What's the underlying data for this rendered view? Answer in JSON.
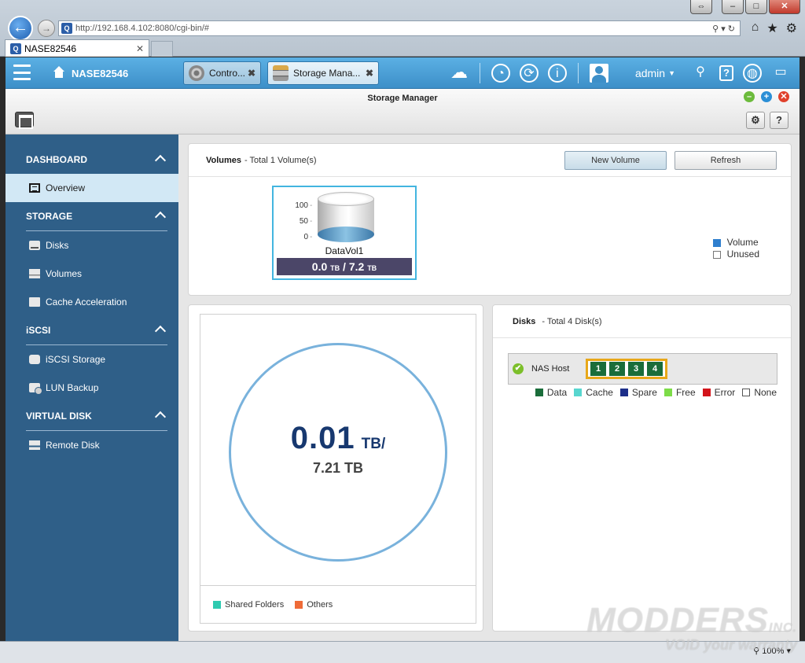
{
  "browser": {
    "url_host": "http://192.168.4.102",
    "url_rest": ":8080/cgi-bin/#",
    "tab_title": "NASE82546",
    "zoom": "100%"
  },
  "header": {
    "host_name": "NASE82546",
    "tabs": [
      {
        "label": "Contro..."
      },
      {
        "label": "Storage Mana..."
      }
    ],
    "user": "admin"
  },
  "window": {
    "title": "Storage Manager"
  },
  "sidebar": {
    "sections": [
      {
        "label": "DASHBOARD",
        "items": [
          {
            "label": "Overview"
          }
        ]
      },
      {
        "label": "STORAGE",
        "items": [
          {
            "label": "Disks"
          },
          {
            "label": "Volumes"
          },
          {
            "label": "Cache Acceleration"
          }
        ]
      },
      {
        "label": "iSCSI",
        "items": [
          {
            "label": "iSCSI Storage"
          },
          {
            "label": "LUN Backup"
          }
        ]
      },
      {
        "label": "VIRTUAL DISK",
        "items": [
          {
            "label": "Remote Disk"
          }
        ]
      }
    ]
  },
  "volumes": {
    "title": "Volumes",
    "subtitle": "- Total 1 Volume(s)",
    "new_label": "New Volume",
    "refresh_label": "Refresh",
    "scale": [
      "100",
      "50",
      "0"
    ],
    "volume_name": "DataVol1",
    "used": "0.0",
    "used_unit": "TB",
    "separator": "/",
    "total": "7.2",
    "total_unit": "TB",
    "legend_volume": "Volume",
    "legend_unused": "Unused"
  },
  "capacity": {
    "used": "0.01",
    "used_unit": "TB/",
    "total": "7.21 TB",
    "legend_shared": "Shared Folders",
    "legend_others": "Others"
  },
  "disks": {
    "title": "Disks",
    "subtitle": "- Total 4 Disk(s)",
    "host_label": "NAS Host",
    "bays": [
      "1",
      "2",
      "3",
      "4"
    ],
    "legend": [
      "Data",
      "Cache",
      "Spare",
      "Free",
      "Error",
      "None"
    ]
  },
  "watermark": {
    "line1": "MODDERS",
    "line2": "VOID your warranty",
    "inc": "INC."
  },
  "colors": {
    "header": "#3d8fc8",
    "sidebar": "#2f5f88",
    "data": "#1a6d3a",
    "cache": "#58d6cf",
    "spare": "#1d2f8a",
    "free": "#7ddc48",
    "error": "#d3141b",
    "volume": "#2f7fce",
    "shared_folders": "#2ecab0",
    "others": "#ef6b38"
  }
}
